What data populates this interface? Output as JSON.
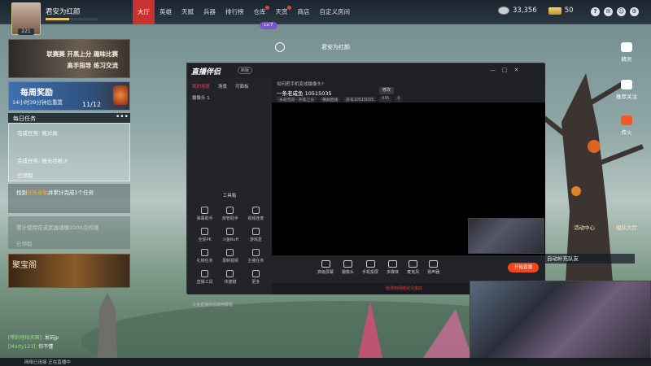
{
  "player": {
    "name": "君安为红颜",
    "level": "221",
    "xp_progress": 0.45
  },
  "nav": {
    "items": [
      {
        "label": "大厅",
        "active": true,
        "dot": false
      },
      {
        "label": "英雄",
        "active": false,
        "dot": false
      },
      {
        "label": "天赋",
        "active": false,
        "dot": false
      },
      {
        "label": "兵器",
        "active": false,
        "dot": false
      },
      {
        "label": "排行榜",
        "active": false,
        "dot": false
      },
      {
        "label": "仓库",
        "active": false,
        "dot": true
      },
      {
        "label": "天赏",
        "active": false,
        "dot": true
      },
      {
        "label": "商店",
        "active": false,
        "dot": false
      },
      {
        "label": "自定义房间",
        "active": false,
        "dot": false
      }
    ],
    "level_badge": "Lv.7"
  },
  "currency": {
    "silver": "33,356",
    "gold": "50"
  },
  "top_icons": [
    "help-icon",
    "mail-icon",
    "friends-icon",
    "settings-icon"
  ],
  "event_banner": {
    "line1": "联赛赛 开黑上分 趣味比赛",
    "line2": "高手指导 练习交流"
  },
  "weekly": {
    "title": "每周奖励",
    "time": "14小时39分钟后重置",
    "count": "11/12"
  },
  "daily": {
    "title": "每日任务",
    "more": "•••",
    "tasks": [
      {
        "text": "完成任务: 络对局"
      },
      {
        "text": "完成任务: 络无尽枪火"
      },
      {
        "text": "已领取"
      }
    ]
  },
  "find_task": {
    "prefix": "找到",
    "highlight": "任务卷轴",
    "suffix": "并累计完成1个任务"
  },
  "collect_task": {
    "text": "累计使用花或武器魂魄2000点的魂",
    "claimed": "已领取"
  },
  "treasure": {
    "title": "聚宝阁"
  },
  "room": {
    "name": "君安为红颜"
  },
  "right_column": [
    {
      "label": "精灵",
      "icon": "headset-icon"
    },
    {
      "label": "推荐关注",
      "icon": "camera-icon"
    },
    {
      "label": "传火",
      "icon": "flame-icon"
    }
  ],
  "activity": {
    "label": "活动中心"
  },
  "party": {
    "label": "组队大厅"
  },
  "match_bar": {
    "text": "自动补充队友"
  },
  "chat": [
    {
      "name": "[帮的地狱天国]:",
      "text": "发玩jp"
    },
    {
      "name": "[Morty123]:",
      "text": "你不懂"
    }
  ],
  "app": {
    "logo": "直播伴侣",
    "version": "新版",
    "window_controls": [
      "—",
      "□",
      "✕"
    ],
    "side_tabs": [
      "我的场景",
      "场景",
      "可面板"
    ],
    "scene_item": "摄像头 1",
    "tools_title": "工具箱",
    "tools": [
      "弹幕助手",
      "房管助手",
      "视频连麦",
      "全民PK",
      "斗鱼Buff",
      "游戏盒",
      "礼物任务",
      "录制视频",
      "主播任务",
      "直播工具",
      "快捷键",
      "更多"
    ],
    "side_hint": "斗鱼直播伴侣使用教程",
    "notice": "如何把手机变成摄像头?",
    "room_title": "一条老咸鱼 10515035",
    "modify_label": "修改",
    "tags": [
      "永劫无间 · 开黑上分",
      "横屏直播",
      "房号10515035",
      "435",
      "0"
    ],
    "controls": [
      "高级屏幕",
      "摄像头",
      "手机投屏",
      "多媒体",
      "麦克风",
      "扬声器"
    ],
    "start_label": "开始直播",
    "status": "检测到网络状况良好"
  },
  "taskbar": {
    "text": "网络已连接 正在直播中"
  }
}
